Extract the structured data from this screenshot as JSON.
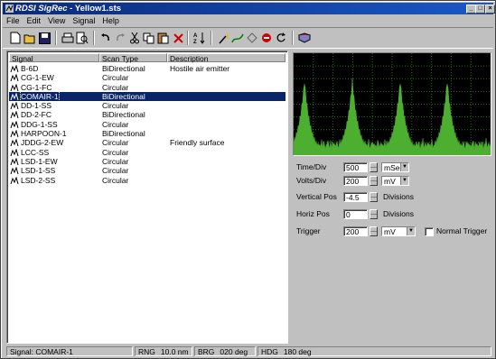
{
  "window": {
    "app_name": "RDSI SigRec",
    "doc_title": " - Yellow1.sts",
    "min_label": "_",
    "max_label": "□",
    "close_label": "×"
  },
  "menu": [
    "File",
    "Edit",
    "View",
    "Signal",
    "Help"
  ],
  "toolbar": {
    "buttons": [
      "new-icon",
      "open-icon",
      "save-icon",
      "print-icon",
      "print-preview-icon",
      "undo-icon",
      "redo-icon",
      "cut-icon",
      "copy-icon",
      "paste-icon",
      "delete-icon",
      "sort-icon",
      "wand-icon",
      "draw-icon",
      "diamond-icon",
      "stop-icon",
      "refresh-icon",
      "book-icon"
    ]
  },
  "list": {
    "columns": [
      "Signal",
      "Scan Type",
      "Description"
    ],
    "rows": [
      {
        "signal": "B-6D",
        "scan": "BiDirectional",
        "desc": "Hostile air emitter"
      },
      {
        "signal": "CG-1-EW",
        "scan": "Circular",
        "desc": ""
      },
      {
        "signal": "CG-1-FC",
        "scan": "Circular",
        "desc": ""
      },
      {
        "signal": "COMAIR-1",
        "scan": "BiDirectional",
        "desc": "",
        "selected": true
      },
      {
        "signal": "DD-1-SS",
        "scan": "Circular",
        "desc": ""
      },
      {
        "signal": "DD-2-FC",
        "scan": "BiDirectional",
        "desc": ""
      },
      {
        "signal": "DDG-1-SS",
        "scan": "Circular",
        "desc": ""
      },
      {
        "signal": "HARPOON-1",
        "scan": "BiDirectional",
        "desc": ""
      },
      {
        "signal": "JDDG-2-EW",
        "scan": "Circular",
        "desc": "Friendly surface"
      },
      {
        "signal": "LCC-SS",
        "scan": "Circular",
        "desc": ""
      },
      {
        "signal": "LSD-1-EW",
        "scan": "Circular",
        "desc": ""
      },
      {
        "signal": "LSD-1-SS",
        "scan": "Circular",
        "desc": ""
      },
      {
        "signal": "LSD-2-SS",
        "scan": "Circular",
        "desc": ""
      }
    ]
  },
  "scope": {
    "trace_color": "#4caf30",
    "grid_color": "#2a6a2a"
  },
  "controls": {
    "time_div": {
      "label": "Time/Div",
      "value": "500",
      "unit": "mSec"
    },
    "volts_div": {
      "label": "Volts/Div",
      "value": "200",
      "unit": "mV"
    },
    "vertical_pos": {
      "label": "Vertical Pos",
      "value": "-4.5",
      "suffix": "Divisions"
    },
    "horiz_pos": {
      "label": "Horiz Pos",
      "value": "0",
      "suffix": "Divisions"
    },
    "trigger": {
      "label": "Trigger",
      "value": "200",
      "unit": "mV",
      "checkbox_label": "Normal Trigger"
    }
  },
  "statusbar": {
    "signal": "Signal: COMAIR-1",
    "rng_label": "RNG",
    "rng_value": "10.0 nm",
    "brg_label": "BRG",
    "brg_value": "020 deg",
    "hdg_label": "HDG",
    "hdg_value": "180 deg"
  }
}
